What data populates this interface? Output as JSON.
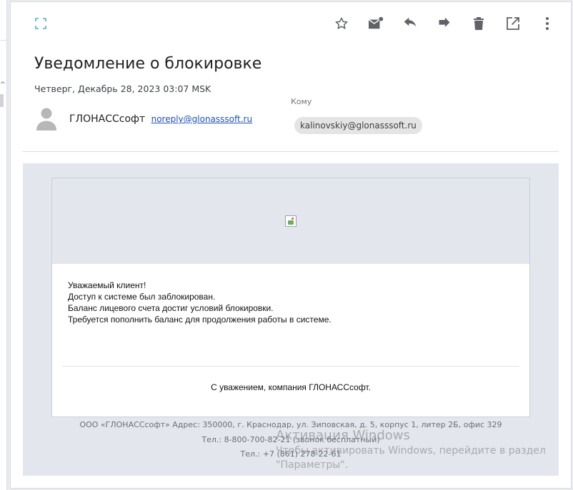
{
  "message": {
    "subject": "Уведомление о блокировке",
    "date": "Четверг, Декабрь 28, 2023 03:07 MSK",
    "sender_name": "ГЛОНАССсофт",
    "sender_email": "noreply@glonasssoft.ru",
    "to_label": "Кому",
    "recipient": "kalinovskiy@glonasssoft.ru"
  },
  "toolbar": {
    "expand_icon": "fullscreen-icon",
    "actions": [
      "star-icon",
      "mark-unread-icon",
      "reply-icon",
      "forward-icon",
      "delete-icon",
      "open-external-icon",
      "more-vert-icon"
    ]
  },
  "body": {
    "lines": [
      "Уважаемый клиент!",
      "Доступ к системе был заблокирован.",
      "Баланс лицевого счета достиг условий блокировки.",
      "Требуется пополнить баланс для продолжения работы в системе."
    ],
    "signoff": "С уважением, компания ГЛОНАССсофт."
  },
  "footer": {
    "address": "ООО «ГЛОНАССсофт» Адрес: 350000, г. Краснодар, ул. Зиповская, д. 5, корпус 1, литер 2Б, офис 329",
    "phone1": "Тел.: 8-800-700-82-21 (звонок бесплатный)",
    "phone2": "Тел.: +7 (861) 278-22-61"
  },
  "watermark": {
    "title": "Активация Windows",
    "line1": "Чтобы активировать Windows, перейдите в раздел",
    "line2": "\"Параметры\"."
  },
  "colors": {
    "accent": "#4fb3bf",
    "icon": "#5f6368",
    "link": "#1a4fc7"
  }
}
